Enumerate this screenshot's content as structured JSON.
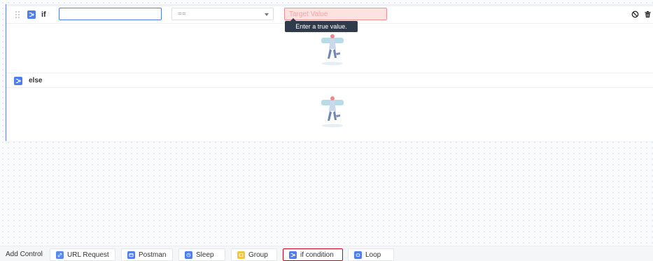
{
  "if_branch": {
    "label": "if",
    "field_value": "",
    "operator": "==",
    "target_placeholder": "Target Value",
    "target_value": "",
    "tooltip": "Enter a true value."
  },
  "else_branch": {
    "label": "else"
  },
  "toolbar": {
    "label": "Add Control",
    "buttons": [
      {
        "label": "URL Request",
        "icon": "link-icon",
        "color": "#5b87f2"
      },
      {
        "label": "Postman",
        "icon": "postman-icon",
        "color": "#4f7df0"
      },
      {
        "label": "Sleep",
        "icon": "clock-icon",
        "color": "#4f7df0"
      },
      {
        "label": "Group",
        "icon": "folder-icon",
        "color": "#f5c542"
      },
      {
        "label": "if condition",
        "icon": "branch-icon",
        "color": "#4f7df0",
        "active": true
      },
      {
        "label": "Loop",
        "icon": "loop-icon",
        "color": "#4f7df0"
      }
    ]
  },
  "colors": {
    "accent": "#4f7df0",
    "error_fill": "#fde2e2",
    "error_border": "#f08f8f",
    "tooltip_bg": "#2f3a4b",
    "active_outline": "#d0021b"
  }
}
